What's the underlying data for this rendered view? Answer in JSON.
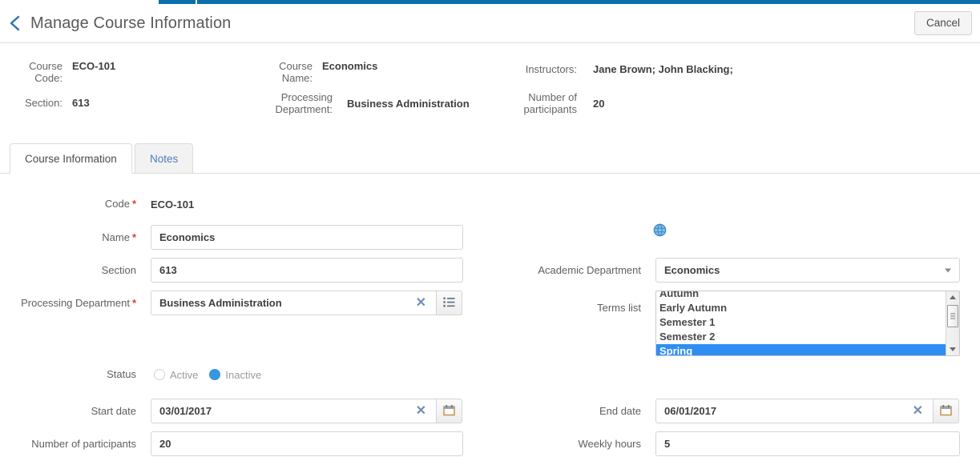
{
  "header": {
    "title": "Manage Course Information",
    "back_icon": "chevron-left-icon",
    "cancel_label": "Cancel"
  },
  "summary": [
    {
      "label": "Course Code:",
      "value": "ECO-101"
    },
    {
      "label": "Course Name:",
      "value": "Economics"
    },
    {
      "label": "Instructors:",
      "value": "Jane Brown; John Blacking;"
    },
    {
      "label": "Section:",
      "value": "613"
    },
    {
      "label": "Processing Department:",
      "value": "Business Administration"
    },
    {
      "label": "Number of participants",
      "value": "20"
    }
  ],
  "tabs": [
    {
      "label": "Course Information",
      "active": true
    },
    {
      "label": "Notes",
      "active": false
    }
  ],
  "form": {
    "code": {
      "label": "Code",
      "required": "*",
      "value": "ECO-101"
    },
    "name": {
      "label": "Name",
      "required": "*",
      "value": "Economics",
      "placeholder": ""
    },
    "section": {
      "label": "Section",
      "value": "613",
      "placeholder": ""
    },
    "processing_department": {
      "label": "Processing Department",
      "required": "*",
      "value": "Business Administration",
      "clear_icon": "close-x-icon",
      "list_icon": "list-picker-icon"
    },
    "status": {
      "label": "Status",
      "options": [
        {
          "label": "Active",
          "selected": false
        },
        {
          "label": "Inactive",
          "selected": true
        }
      ]
    },
    "start_date": {
      "label": "Start date",
      "value": "03/01/2017",
      "clear_icon": "close-x-icon",
      "calendar_icon": "calendar-icon"
    },
    "participants": {
      "label": "Number of participants",
      "value": "20"
    },
    "globe_icon": "globe-translate-icon",
    "academic_department": {
      "label": "Academic Department",
      "value": "Economics",
      "caret_icon": "chevron-down-icon"
    },
    "terms_list": {
      "label": "Terms list",
      "items": [
        {
          "label": "Autumn",
          "selected": false
        },
        {
          "label": "Early Autumn",
          "selected": false
        },
        {
          "label": "Semester 1",
          "selected": false
        },
        {
          "label": "Semester 2",
          "selected": false
        },
        {
          "label": "Spring",
          "selected": true
        }
      ],
      "scroll_up_icon": "scroll-up-arrow-icon",
      "scroll_down_icon": "scroll-down-arrow-icon"
    },
    "end_date": {
      "label": "End date",
      "value": "06/01/2017",
      "clear_icon": "close-x-icon",
      "calendar_icon": "calendar-icon"
    },
    "weekly_hours": {
      "label": "Weekly hours",
      "value": "5"
    }
  },
  "colors": {
    "accent_blue": "#0c6fad",
    "link_blue": "#4f7dbb",
    "selection_blue": "#2f8ef4",
    "required_red": "#e03e2d",
    "radio_on": "#3498db"
  }
}
